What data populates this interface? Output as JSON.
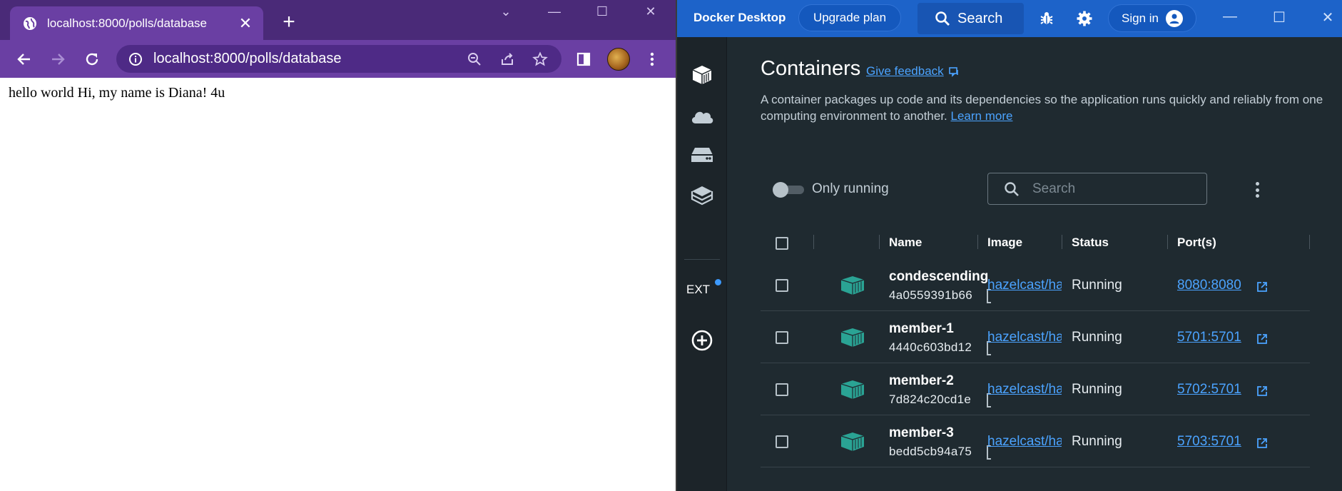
{
  "browser": {
    "tab_title": "localhost:8000/polls/database",
    "url": "localhost:8000/polls/database",
    "page_text": "hello world Hi, my name is Diana! 4u",
    "accent_color": "#6a3fa3"
  },
  "docker": {
    "app_title": "Docker Desktop",
    "upgrade_label": "Upgrade plan",
    "search_label": "Search",
    "signin_label": "Sign in",
    "sidebar": {
      "ext_label": "EXT"
    },
    "containers": {
      "title": "Containers",
      "feedback_label": "Give feedback",
      "description": "A container packages up code and its dependencies so the application runs quickly and reliably from one computing environment to another.",
      "learn_more": "Learn more",
      "only_running_label": "Only running",
      "search_placeholder": "Search",
      "columns": {
        "name": "Name",
        "image": "Image",
        "status": "Status",
        "ports": "Port(s)"
      },
      "rows": [
        {
          "name": "condescending",
          "id": "4a0559391b66",
          "image": "hazelcast/hazelcast",
          "status": "Running",
          "port": "8080:8080"
        },
        {
          "name": "member-1",
          "id": "4440c603bd12",
          "image": "hazelcast/hazelcast",
          "status": "Running",
          "port": "5701:5701"
        },
        {
          "name": "member-2",
          "id": "7d824c20cd1e",
          "image": "hazelcast/hazelcast",
          "status": "Running",
          "port": "5702:5701"
        },
        {
          "name": "member-3",
          "id": "bedd5cb94a75",
          "image": "hazelcast/hazelcast",
          "status": "Running",
          "port": "5703:5701"
        }
      ]
    },
    "colors": {
      "titlebar": "#1d63c9",
      "background": "#1f2a30",
      "link": "#4ba3ff",
      "container_icon": "#2aa394"
    }
  }
}
